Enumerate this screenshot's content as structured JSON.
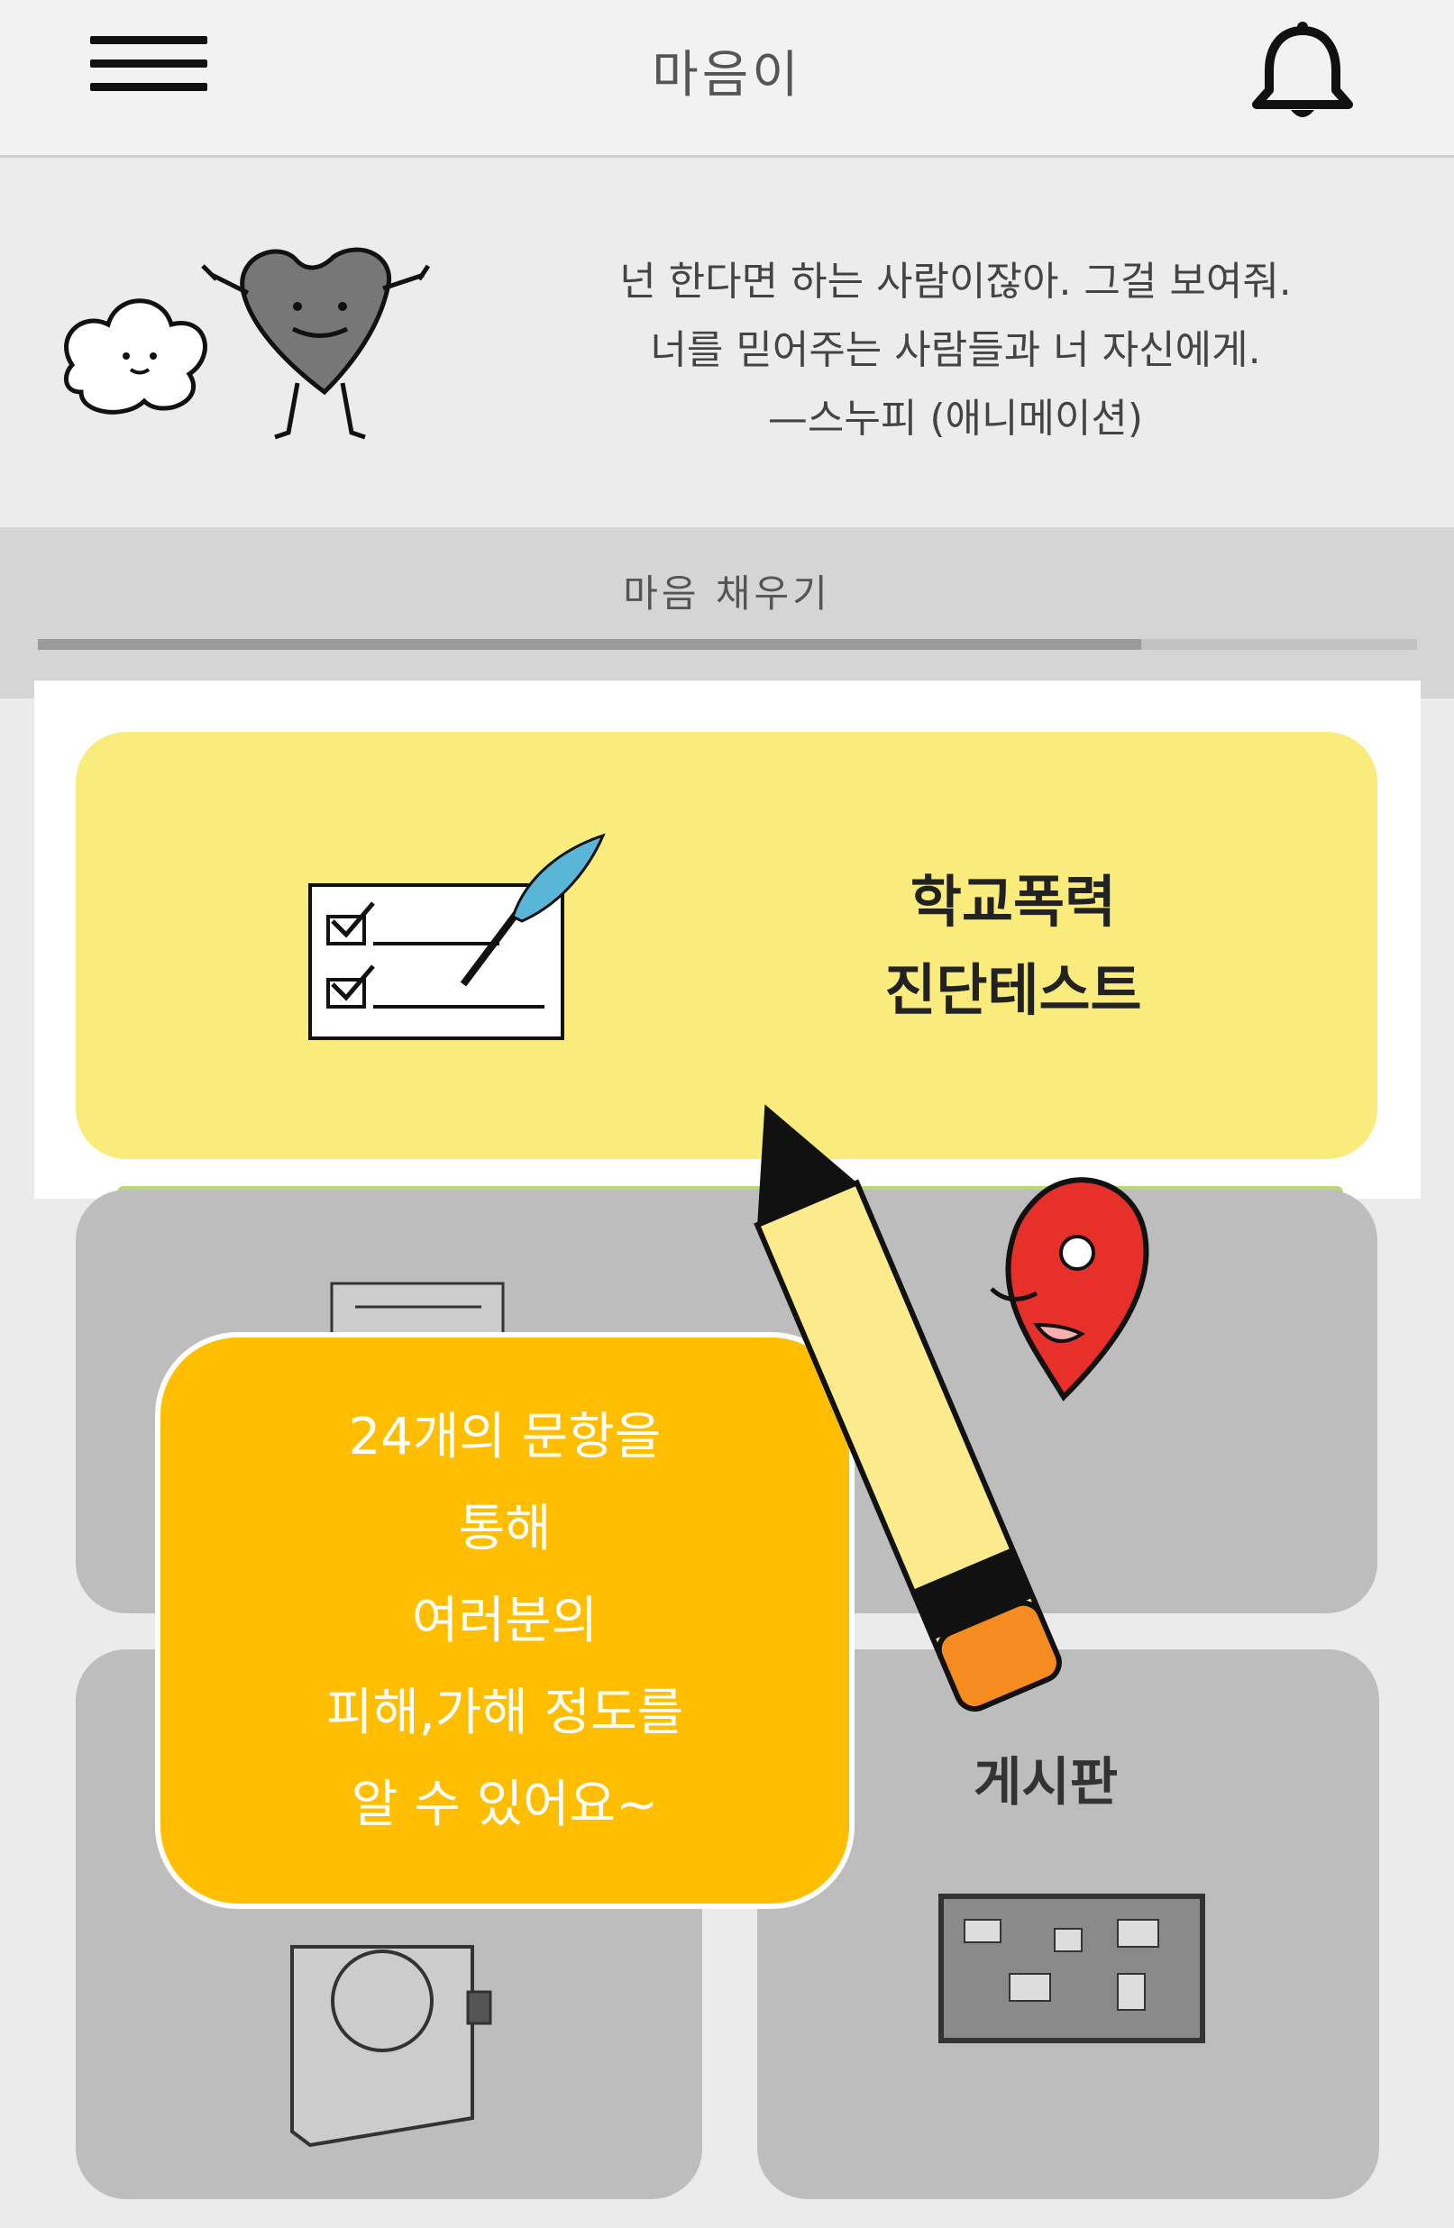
{
  "header": {
    "title": "마음이",
    "menu_icon": "hamburger-menu-icon",
    "notification_icon": "bell-icon"
  },
  "quote": {
    "lines": [
      "넌 한다면 하는 사람이잖아. 그걸 보여줘.",
      "너를 믿어주는 사람들과 너 자신에게.",
      "—스누피 (애니메이션)"
    ]
  },
  "tab": {
    "label": "마음 채우기",
    "progress_fraction": 0.8
  },
  "cards": {
    "test": {
      "title_line1": "학교폭력",
      "title_line2": "진단테스트"
    },
    "board": {
      "label": "게시판"
    }
  },
  "tooltip": {
    "lines": [
      "24개의 문항을",
      "통해",
      "여러분의",
      "피해,가해 정도를",
      "알 수 있어요~"
    ]
  },
  "colors": {
    "test_card": "#f9ec7d",
    "tooltip": "#ffbf00",
    "grey_card": "#bdbdbd",
    "heart_mascot": "#e8302a"
  }
}
